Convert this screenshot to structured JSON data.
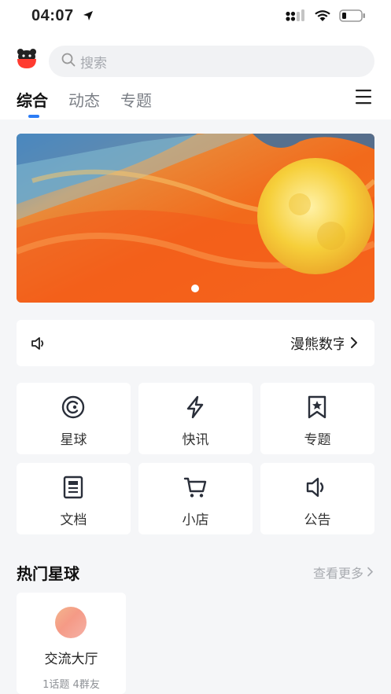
{
  "status_bar": {
    "time": "04:07"
  },
  "search": {
    "placeholder": "搜索"
  },
  "tabs": [
    {
      "label": "综合",
      "active": true
    },
    {
      "label": "动态",
      "active": false
    },
    {
      "label": "专题",
      "active": false
    }
  ],
  "notice": {
    "text": "漫熊数字"
  },
  "shortcuts": [
    {
      "label": "星球",
      "icon": "planet-icon"
    },
    {
      "label": "快讯",
      "icon": "lightning-icon"
    },
    {
      "label": "专题",
      "icon": "bookmark-star-icon"
    },
    {
      "label": "文档",
      "icon": "document-icon"
    },
    {
      "label": "小店",
      "icon": "cart-icon"
    },
    {
      "label": "公告",
      "icon": "speaker-icon"
    }
  ],
  "hot_section": {
    "title": "热门星球",
    "more_label": "查看更多"
  },
  "planet_cards": [
    {
      "name": "交流大厅",
      "meta": "1话题 4群友"
    }
  ],
  "colors": {
    "accent": "#2b7cf5",
    "background": "#f5f6f8"
  }
}
